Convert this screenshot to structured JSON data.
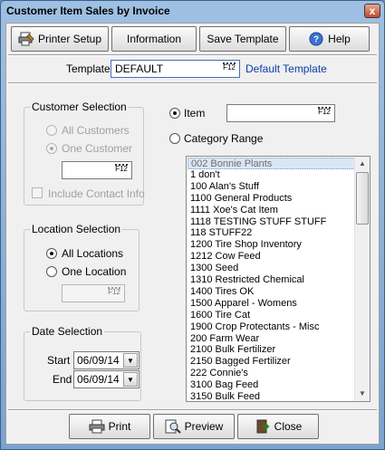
{
  "window": {
    "title": "Customer Item Sales by Invoice",
    "close_glyph": "x"
  },
  "toolbar": {
    "printer_setup": "Printer Setup",
    "information": "Information",
    "save_template": "Save Template",
    "help": "Help"
  },
  "template": {
    "label": "Template",
    "value": "DEFAULT",
    "description": "Default Template"
  },
  "f12_label": "F12",
  "customer_selection": {
    "title": "Customer Selection",
    "all_customers": "All Customers",
    "one_customer": "One Customer",
    "customer_value": "",
    "include_contact_info": "Include Contact Info"
  },
  "location_selection": {
    "title": "Location Selection",
    "all_locations": "All Locations",
    "one_location": "One Location",
    "location_value": ""
  },
  "date_selection": {
    "title": "Date Selection",
    "start_label": "Start",
    "start_value": "06/09/14",
    "end_label": "End",
    "end_value": "06/09/14"
  },
  "item_mode": {
    "item_label": "Item",
    "item_value": "",
    "category_label": "Category Range"
  },
  "categories": [
    "002 Bonnie Plants",
    "1 don't",
    "100 Alan's Stuff",
    "1100 General Products",
    "1111 Xoe's Cat Item",
    "1118 TESTING STUFF STUFF",
    "118 STUFF22",
    "1200 Tire Shop Inventory",
    "1212 Cow Feed",
    "1300 Seed",
    "1310 Restricted Chemical",
    "1400 Tires OK",
    "1500 Apparel - Womens",
    "1600 Tire Cat",
    "1900 Crop Protectants - Misc",
    "200 Farm Wear",
    "2100 Bulk Fertilizer",
    "2150 Bagged Fertilizer",
    "222 Connie's",
    "3100 Bag Feed",
    "3150 Bulk Feed"
  ],
  "buttons": {
    "print": "Print",
    "preview": "Preview",
    "close": "Close"
  }
}
